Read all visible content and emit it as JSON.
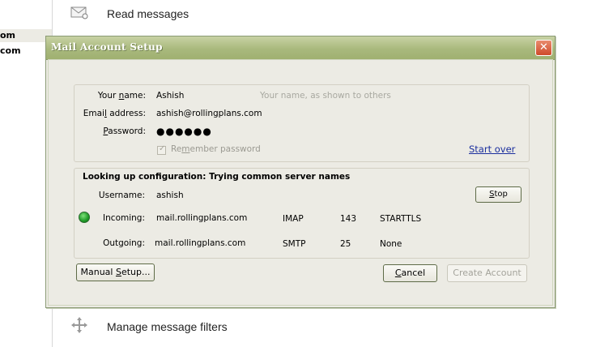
{
  "background": {
    "accounts": [
      "om",
      "com"
    ],
    "read_messages": "Read messages",
    "manage_filters": "Manage message filters"
  },
  "dialog": {
    "title": "Mail Account Setup",
    "close_glyph": "✕",
    "your_name": {
      "label_pre": "Your ",
      "label_u": "n",
      "label_post": "ame:",
      "value": "Ashish",
      "hint": "Your name, as shown to others"
    },
    "email": {
      "label_pre": "Emai",
      "label_u": "l",
      "label_post": " address:",
      "value": "ashish@rollingplans.com"
    },
    "password": {
      "label_pre": "",
      "label_u": "P",
      "label_post": "assword:",
      "value": "●●●●●●"
    },
    "remember": {
      "label_pre": "Re",
      "label_u": "m",
      "label_post": "ember password",
      "checked": true
    },
    "start_over": "Start over",
    "lookup_heading": "Looking up configuration: Trying common server names",
    "username": {
      "label": "Username:",
      "value": "ashish"
    },
    "stop_button": {
      "pre": "",
      "u": "S",
      "post": "top"
    },
    "incoming": {
      "label": "Incoming:",
      "server": "mail.rollingplans.com",
      "protocol": "IMAP",
      "port": "143",
      "security": "STARTTLS",
      "status_color": "#1f9a27"
    },
    "outgoing": {
      "label": "Outgoing:",
      "server": "mail.rollingplans.com",
      "protocol": "SMTP",
      "port": "25",
      "security": "None"
    },
    "manual_setup": {
      "pre": "Manual ",
      "u": "S",
      "post": "etup..."
    },
    "cancel": {
      "pre": "",
      "u": "C",
      "post": "ancel"
    },
    "create_account": "Create Account"
  }
}
